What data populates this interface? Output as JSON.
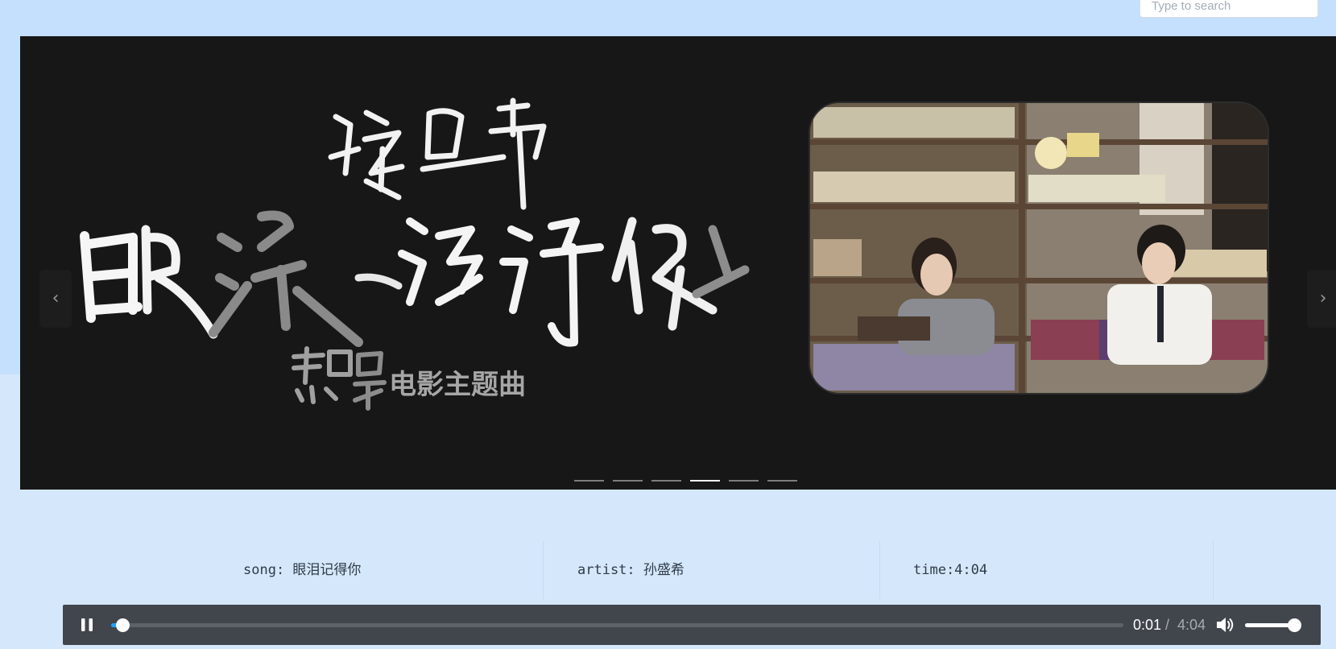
{
  "search": {
    "placeholder": "Type to search"
  },
  "banner": {
    "slide_count": 6,
    "active_slide_index": 3,
    "prev_icon": "chevron-left-icon",
    "next_icon": "chevron-right-icon",
    "art": {
      "artist_signature": "孫盛希",
      "title_calligraphy": "眼淚記得你",
      "subtitle_logo": "想見你",
      "subtitle": "电影主题曲"
    }
  },
  "song_info": {
    "song": "song: 眼泪记得你",
    "artist": "artist: 孙盛希",
    "time": "time:4:04"
  },
  "player": {
    "state": "playing",
    "play_icon": "pause-icon",
    "current_time": "0:01",
    "separator": "/",
    "duration": "4:04",
    "progress_fraction": 0.011,
    "volume_icon": "volume-high-icon",
    "volume_fraction": 0.9,
    "colors": {
      "bar_bg": "#41454c",
      "accent": "#1ea1ff"
    }
  }
}
